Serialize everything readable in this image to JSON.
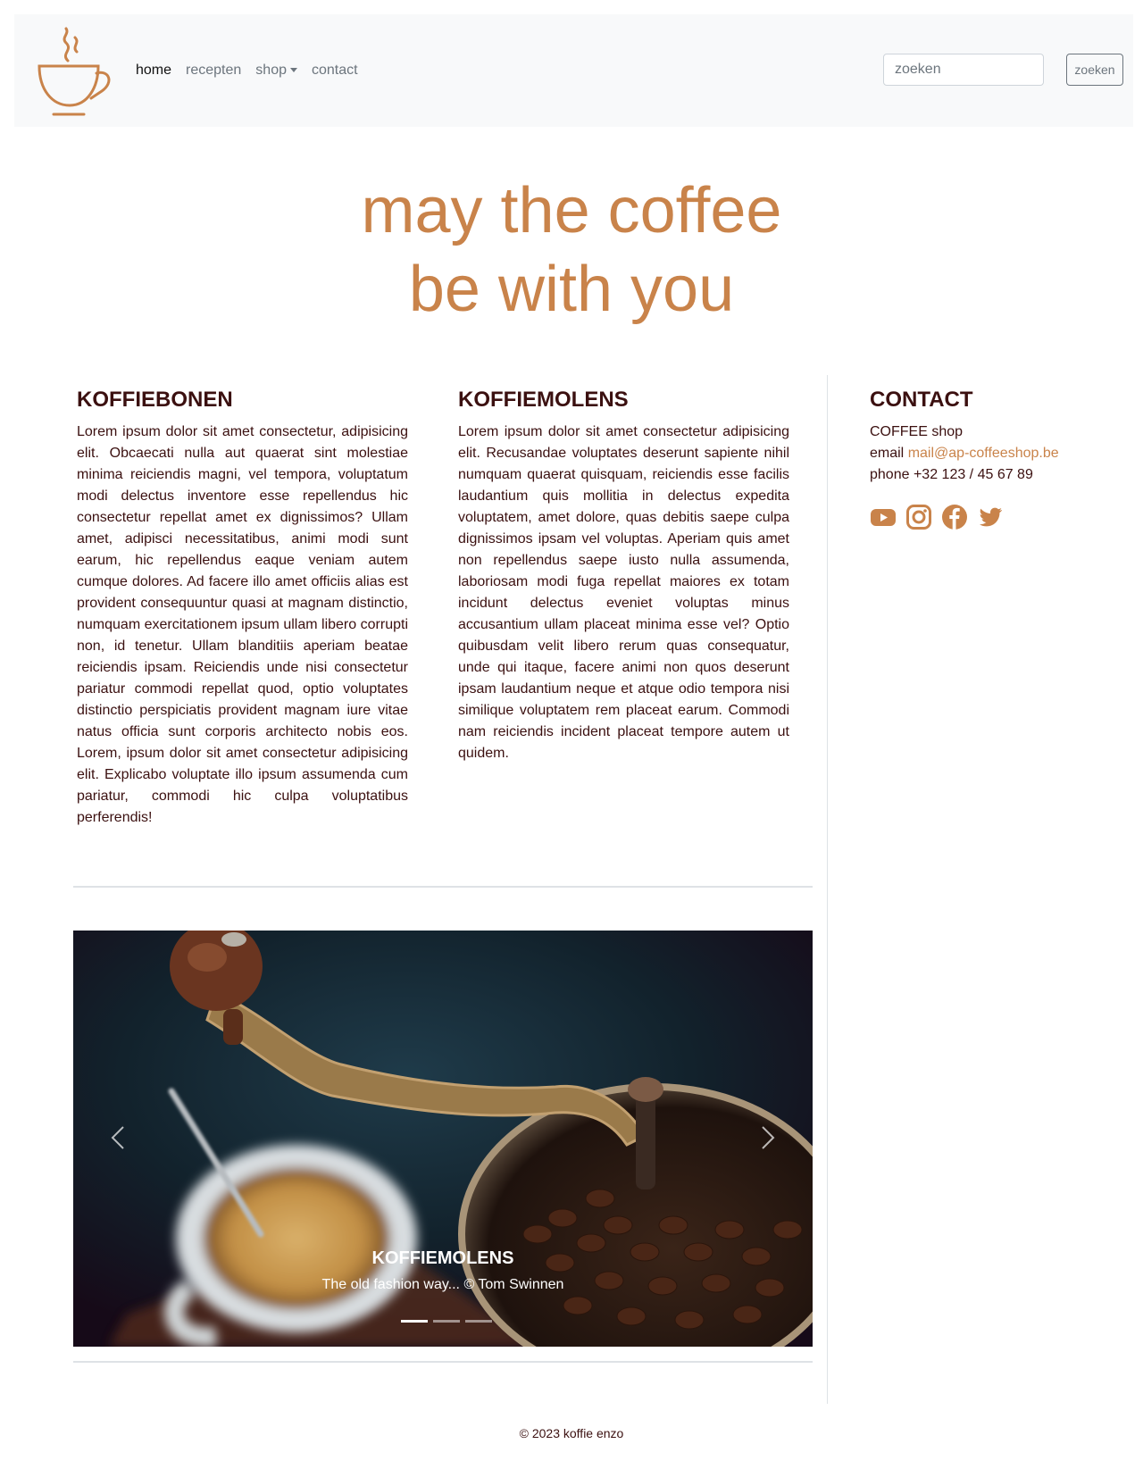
{
  "navbar": {
    "links": [
      {
        "label": "home"
      },
      {
        "label": "recepten"
      },
      {
        "label": "shop"
      },
      {
        "label": "contact"
      }
    ],
    "search": {
      "placeholder": "zoeken",
      "button_label": "zoeken"
    }
  },
  "hero": {
    "line1": "may the coffee",
    "line2": "be with you"
  },
  "columns": {
    "koffiebonen": {
      "title": "KOFFIEBONEN",
      "text": "Lorem ipsum dolor sit amet consectetur, adipisicing elit. Obcaecati nulla aut quaerat sint molestiae minima reiciendis magni, vel tempora, voluptatum modi delectus inventore esse repellendus hic consectetur repellat amet ex dignissimos? Ullam amet, adipisci necessitatibus, animi modi sunt earum, hic repellendus eaque veniam autem cumque dolores. Ad facere illo amet officiis alias est provident consequuntur quasi at magnam distinctio, numquam exercitationem ipsum ullam libero corrupti non, id tenetur. Ullam blanditiis aperiam beatae reiciendis ipsam. Reiciendis unde nisi consectetur pariatur commodi repellat quod, optio voluptates distinctio perspiciatis provident magnam iure vitae natus officia sunt corporis architecto nobis eos. Lorem, ipsum dolor sit amet consectetur adipisicing elit. Explicabo voluptate illo ipsum assumenda cum pariatur, commodi hic culpa voluptatibus perferendis!"
    },
    "koffiemolens": {
      "title": "KOFFIEMOLENS",
      "text": "Lorem ipsum dolor sit amet consectetur adipisicing elit. Recusandae voluptates deserunt sapiente nihil numquam quaerat quisquam, reiciendis esse facilis laudantium quis mollitia in delectus expedita voluptatem, amet dolore, quas debitis saepe culpa dignissimos ipsam vel voluptas. Aperiam quis amet non repellendus saepe iusto nulla assumenda, laboriosam modi fuga repellat maiores ex totam incidunt delectus eveniet voluptas minus accusantium ullam placeat minima esse vel? Optio quibusdam velit libero rerum quas consequatur, unde qui itaque, facere animi non quos deserunt ipsam laudantium neque et atque odio tempora nisi similique voluptatem rem placeat earum. Commodi nam reiciendis incident placeat tempore autem ut quidem."
    }
  },
  "contact": {
    "title": "CONTACT",
    "name": "COFFEE shop",
    "email_label": "email",
    "email": "mail@ap-coffeeshop.be",
    "phone_label": "phone",
    "phone": "+32 123 / 45 67 89",
    "socials": [
      "youtube-icon",
      "instagram-icon",
      "facebook-icon",
      "twitter-icon"
    ]
  },
  "carousel": {
    "caption_title": "KOFFIEMOLENS",
    "caption_text": "The old fashion way... © Tom Swinnen",
    "slide_count": 3,
    "active_index": 0
  },
  "footer": {
    "text": "© 2023 koffie enzo"
  },
  "colors": {
    "accent": "#c9834a",
    "text": "#3b1010",
    "navbar_bg": "#f8f9fa"
  }
}
